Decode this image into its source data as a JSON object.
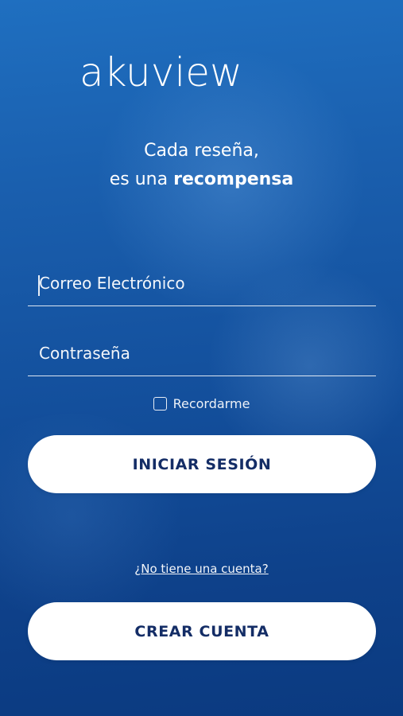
{
  "brand": {
    "logo_text": "akuview"
  },
  "tagline": {
    "line1": "Cada reseña,",
    "line2_prefix": "es una ",
    "line2_bold": "recompensa"
  },
  "form": {
    "email_placeholder": "Correo Electrónico",
    "password_placeholder": "Contraseña",
    "remember_label": "Recordarme",
    "remember_checked": false
  },
  "actions": {
    "login_label": "INICIAR SESIÓN",
    "no_account_link": "¿No tiene una cuenta?",
    "create_account_label": "CREAR CUENTA"
  },
  "colors": {
    "background_top": "#1f6fc0",
    "background_bottom": "#0b3a80",
    "button_bg": "#ffffff",
    "button_text": "#142d66"
  }
}
